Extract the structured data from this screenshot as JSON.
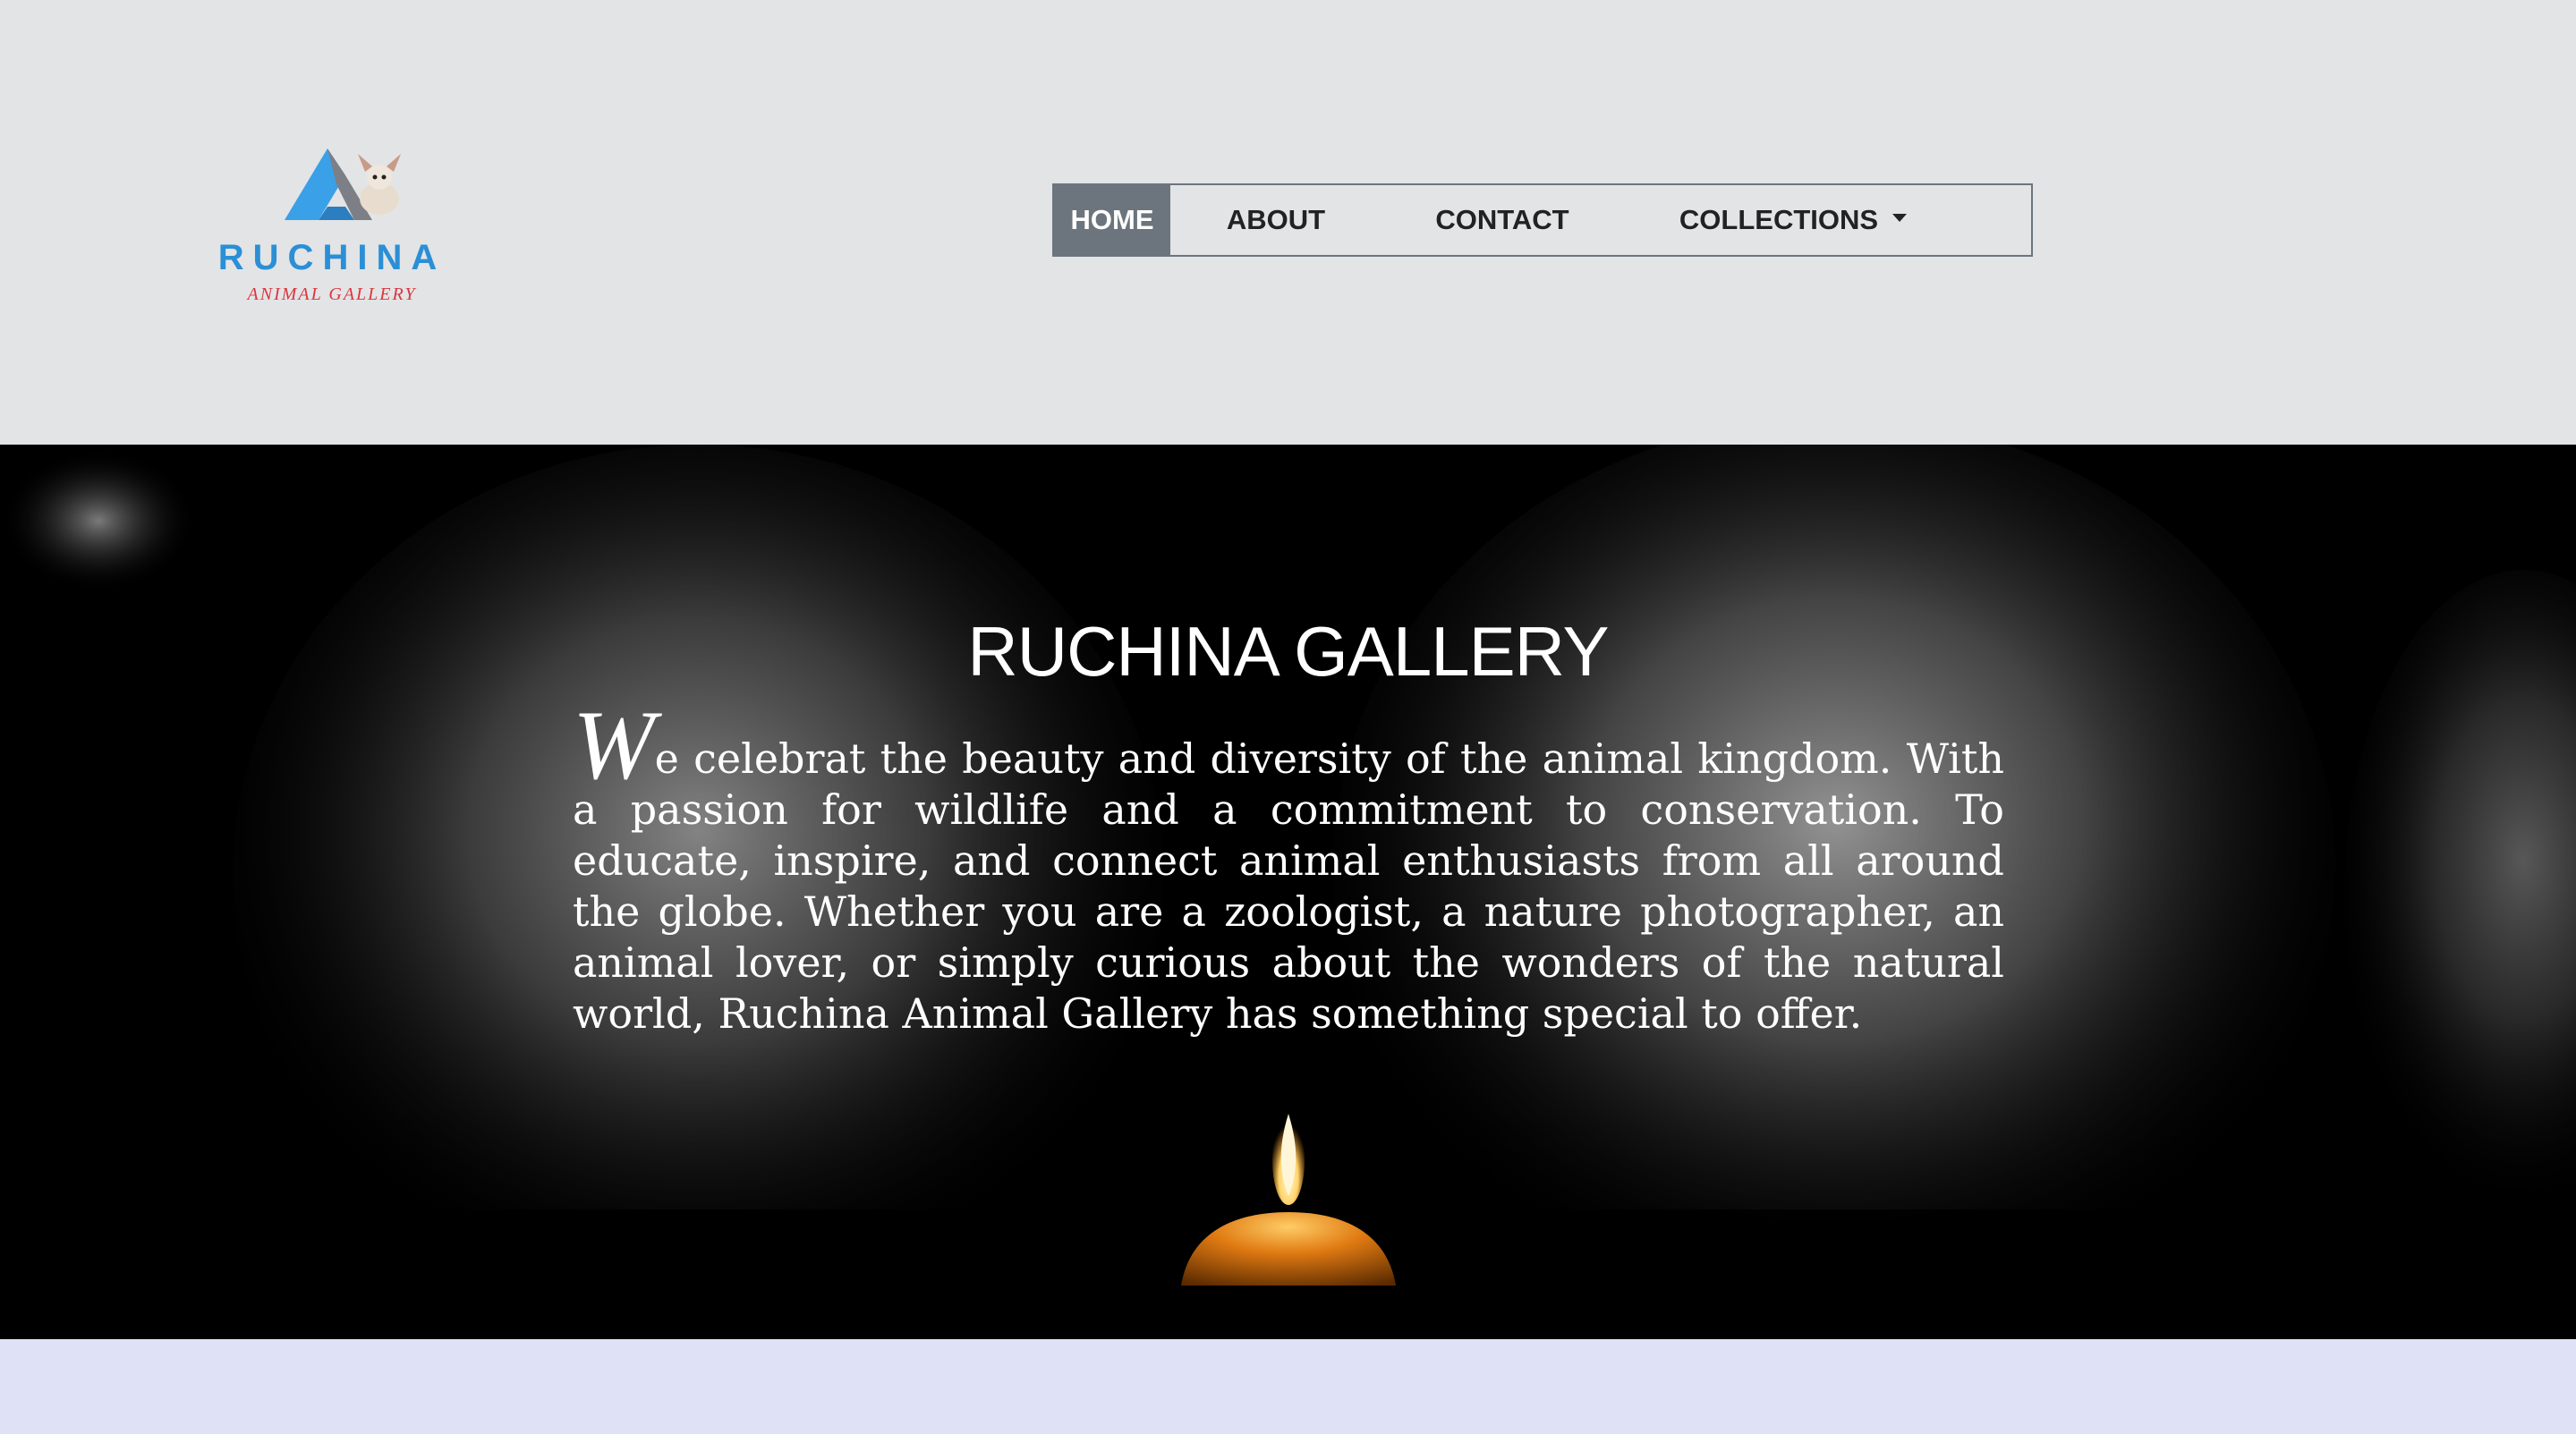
{
  "logo": {
    "brand": "RUCHINA",
    "tagline": "ANIMAL GALLERY",
    "brand_color": "#2b8fd6",
    "tagline_color": "#d9363e"
  },
  "nav": {
    "items": [
      {
        "label": "HOME",
        "active": true
      },
      {
        "label": "ABOUT",
        "active": false
      },
      {
        "label": "CONTACT",
        "active": false
      },
      {
        "label": "COLLECTIONS",
        "active": false,
        "dropdown": true
      }
    ],
    "active_color": "#6c757d"
  },
  "hero": {
    "title": "RUCHINA GALLERY",
    "dropcap": "W",
    "text": "e celebrat the beauty and diversity of the animal kingdom. With a passion for wildlife and a commitment to conservation. To educate, inspire, and connect animal enthusiasts from all around the globe. Whether you are a zoologist, a nature photographer, an animal lover, or simply curious about the wonders of the natural world, Ruchina Animal Gallery has something special to offer."
  },
  "colors": {
    "header_bg": "#e3e4e6",
    "hero_bg": "#000000",
    "footer_bg": "#dfe2f6"
  }
}
